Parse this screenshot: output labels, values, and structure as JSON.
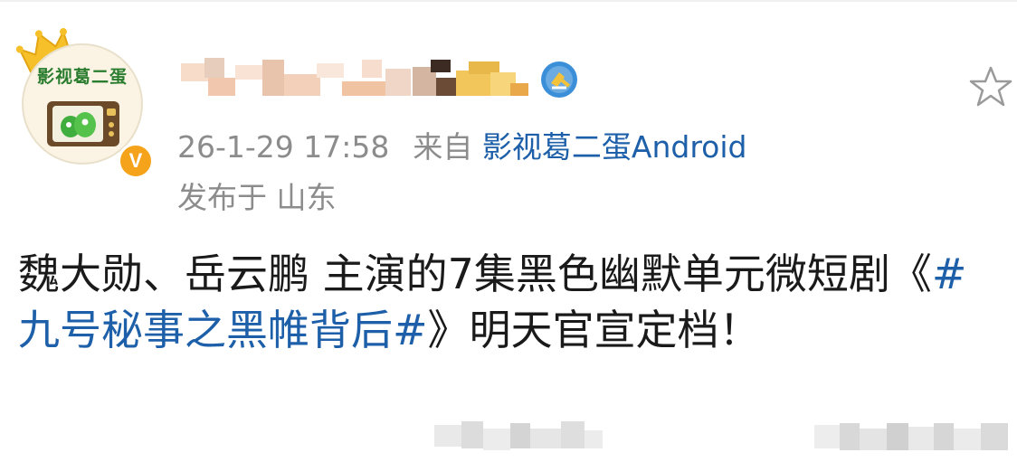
{
  "avatar": {
    "text": "影视葛二蛋",
    "badge": "V",
    "accent": "#f5a31a",
    "icon": "tv-mascot-icon"
  },
  "header": {
    "icons": {
      "verified": "verified-shield-icon",
      "favorite": "star-icon",
      "crown": "crown-icon"
    }
  },
  "meta": {
    "timestamp": "26-1-29 17:58",
    "source_prefix": "来自",
    "source_name": "影视葛二蛋Android",
    "location": "发布于 山东"
  },
  "post": {
    "text_part1": "魏大勋、岳云鹏 主演的7集黑色幽默单元微短剧《",
    "hashtag": "#九号秘事之黑帷背后#",
    "text_part2": "》明天官宣定档！"
  },
  "colors": {
    "link": "#1d5fa8",
    "meta_gray": "#8c8c8c",
    "text": "#1a1a1a"
  }
}
